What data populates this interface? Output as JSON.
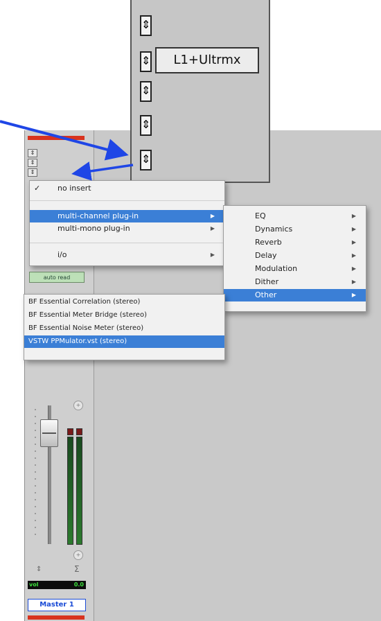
{
  "zoom_panel": {
    "insert_label": "L1+Ultrmx",
    "stepper_glyph": "⇕"
  },
  "channel_strip": {
    "auto_mode": "auto read",
    "pan_glyph": "⇕",
    "solo_glyph": "Σ",
    "vol_label": "vol",
    "vol_value": "0.0",
    "track_name": "Master 1"
  },
  "insert_menu": {
    "items": [
      {
        "label": "no insert",
        "checked": true
      },
      {
        "label": "multi-channel plug-in",
        "submenu": true,
        "selected": true
      },
      {
        "label": "multi-mono plug-in",
        "submenu": true
      },
      {
        "label": "i/o",
        "submenu": true
      }
    ],
    "check_glyph": "✓",
    "submenu_glyph": "▶"
  },
  "category_menu": {
    "items": [
      {
        "label": "EQ"
      },
      {
        "label": "Dynamics"
      },
      {
        "label": "Reverb"
      },
      {
        "label": "Delay"
      },
      {
        "label": "Modulation"
      },
      {
        "label": "Dither"
      },
      {
        "label": "Other",
        "selected": true
      }
    ]
  },
  "plugin_menu": {
    "items": [
      {
        "label": "BF Essential Correlation (stereo)"
      },
      {
        "label": "BF Essential Meter Bridge (stereo)"
      },
      {
        "label": "BF Essential Noise Meter (stereo)"
      },
      {
        "label": "VSTW PPMulator.vst (stereo)",
        "selected": true
      }
    ]
  },
  "colors": {
    "selection": "#3b7fd6",
    "arrow": "#1f46e6",
    "red_bar": "#d8331e",
    "meter_green": "#2c7a2e",
    "track_name": "#1a4bd6"
  }
}
